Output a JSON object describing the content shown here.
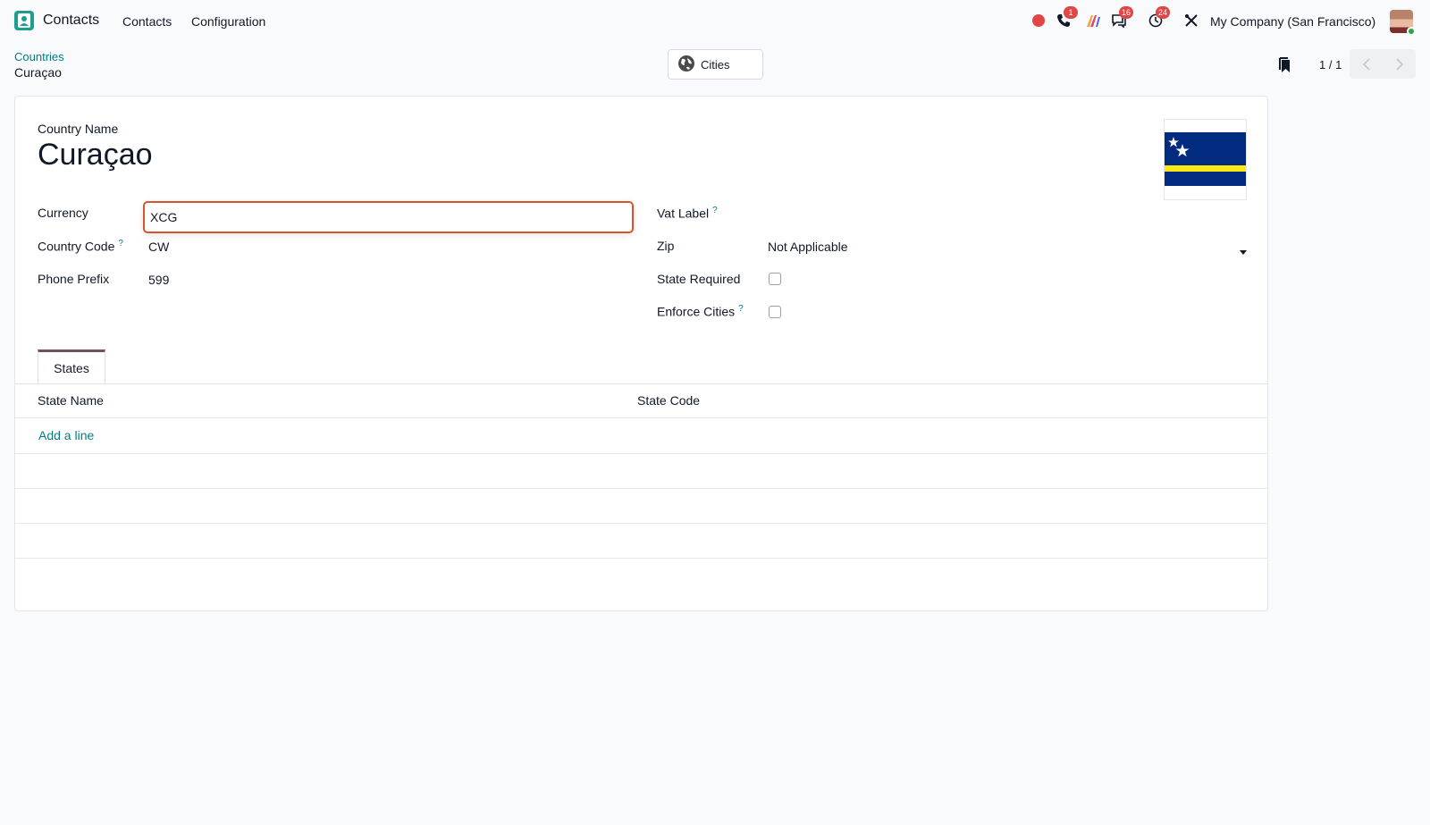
{
  "navbar": {
    "app_name": "Contacts",
    "menu": [
      "Contacts",
      "Configuration"
    ],
    "badges": {
      "phone": "1",
      "messages": "16",
      "activities": "24"
    },
    "company": "My Company (San Francisco)",
    "icons": [
      "record-dot-icon",
      "phone-icon",
      "ai-icon",
      "chat-icon",
      "clock-icon",
      "tools-icon"
    ]
  },
  "control_panel": {
    "breadcrumb_parent": "Countries",
    "breadcrumb_current": "Curaçao",
    "smart_button": "Cities",
    "pager": "1 / 1"
  },
  "form": {
    "title_label": "Country Name",
    "title": "Curaçao",
    "left_fields": [
      {
        "label": "Currency",
        "value": "XCG"
      },
      {
        "label": "Country Code",
        "value": "CW"
      },
      {
        "label": "Phone Prefix",
        "value": "599"
      }
    ],
    "right_fields": [
      {
        "label": "Vat Label",
        "value": ""
      },
      {
        "label": "Zip",
        "value": "Not Applicable"
      },
      {
        "label": "State Required",
        "checked": false
      },
      {
        "label": "Enforce Cities",
        "checked": false
      }
    ],
    "help_mark": "?"
  },
  "tabs": [
    "States"
  ],
  "states_table": {
    "columns": [
      "State Name",
      "State Code"
    ],
    "add_line": "Add a line"
  },
  "colors": {
    "accent": "#017e84",
    "focus_border": "#d9532c",
    "tab_top": "#71505f",
    "badge": "#e04646",
    "flag_blue": "#002b7f",
    "flag_yellow": "#f9e814"
  }
}
